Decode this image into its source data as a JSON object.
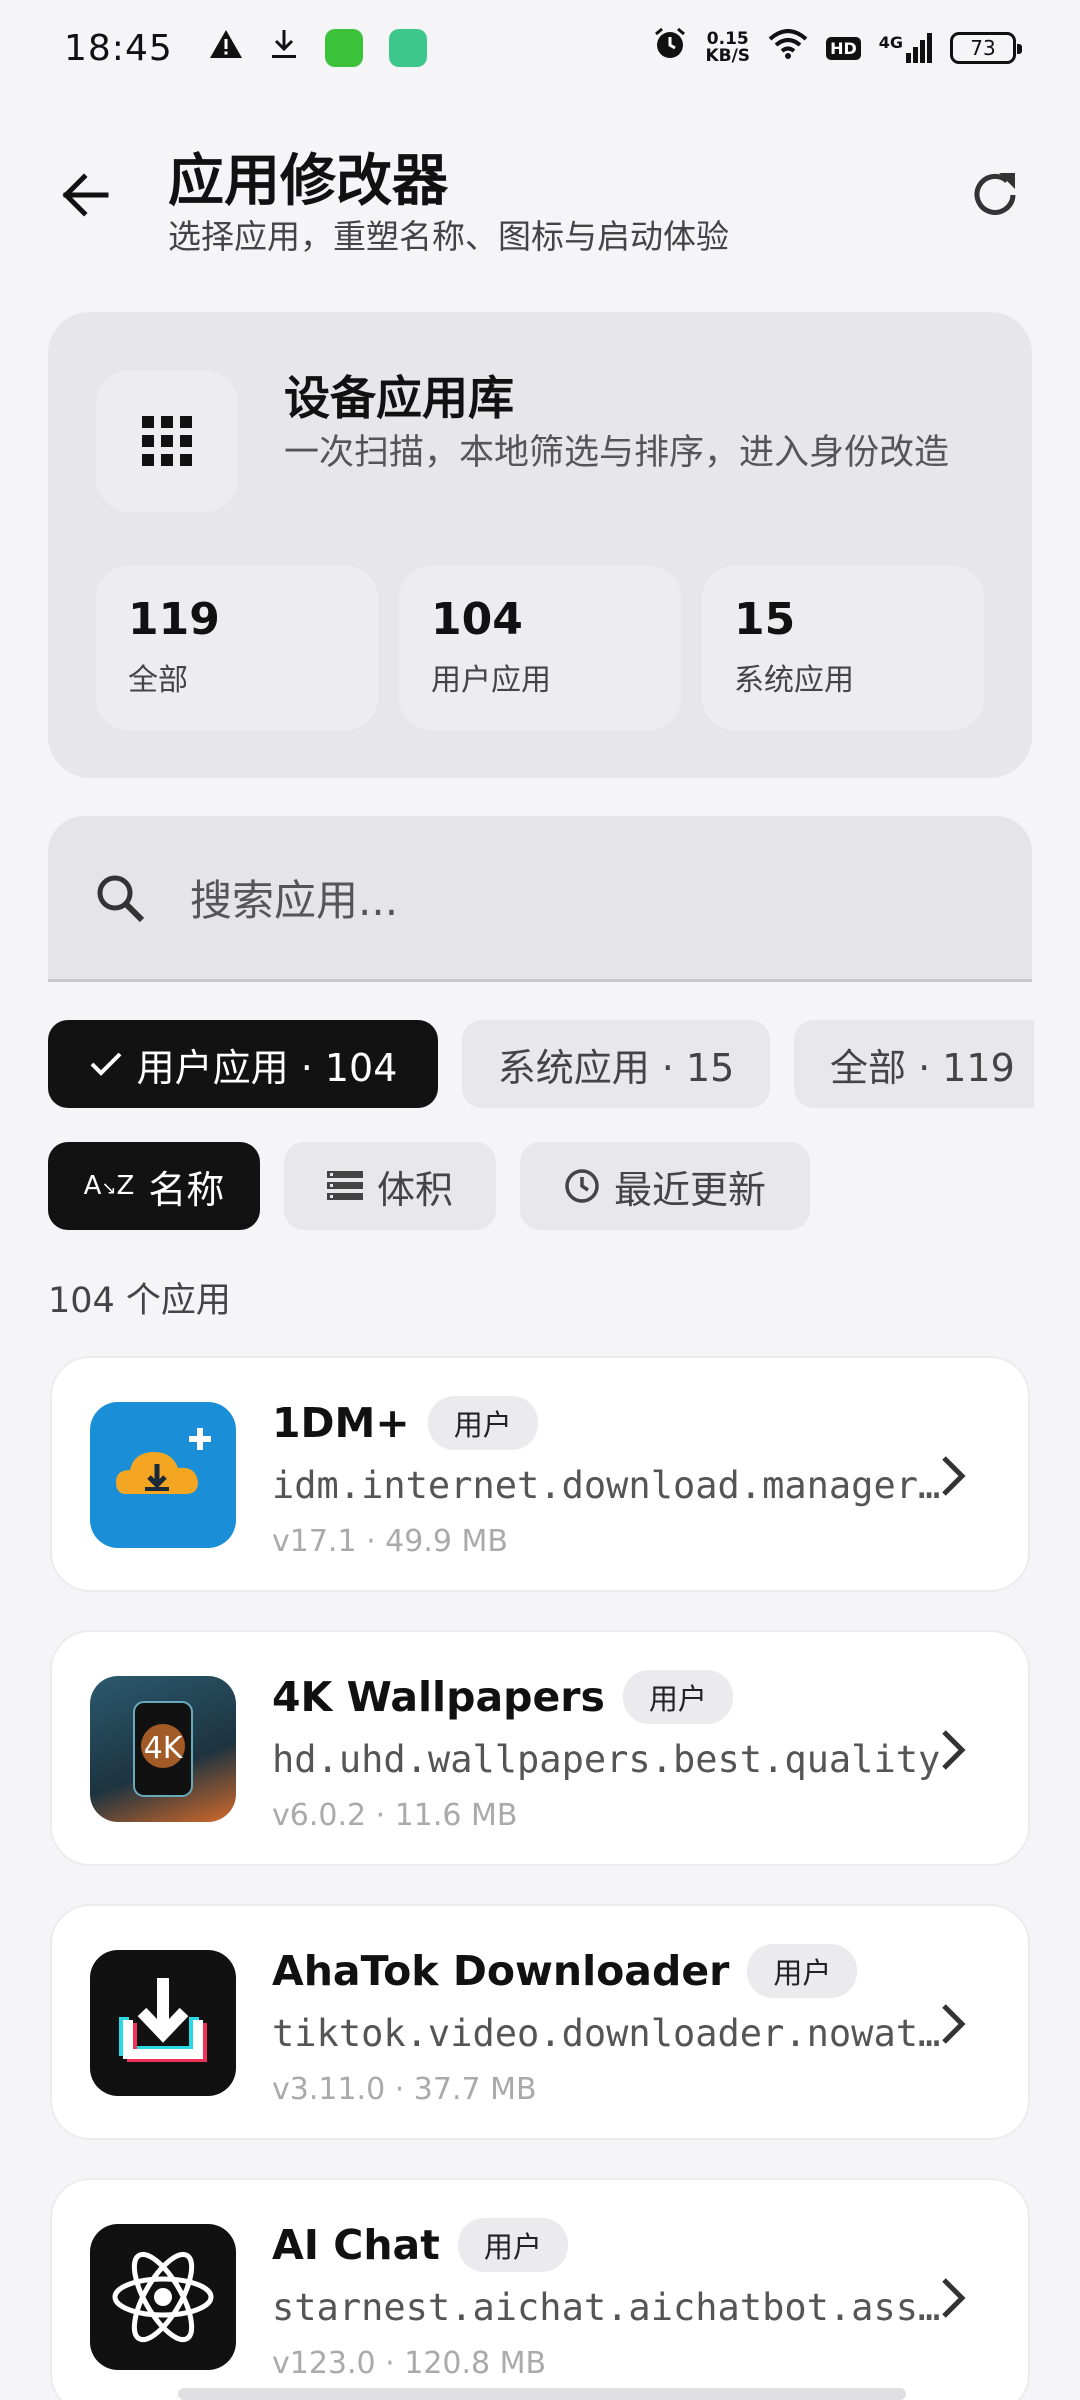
{
  "status_bar": {
    "time": "18:45",
    "net_speed_value": "0.15",
    "net_speed_unit": "KB/S",
    "hd": "HD",
    "signal": "4G",
    "battery": "73"
  },
  "header": {
    "title": "应用修改器",
    "subtitle": "选择应用，重塑名称、图标与启动体验"
  },
  "library": {
    "title": "设备应用库",
    "description": "一次扫描，本地筛选与排序，进入身份改造",
    "stats": [
      {
        "value": "119",
        "label": "全部"
      },
      {
        "value": "104",
        "label": "用户应用"
      },
      {
        "value": "15",
        "label": "系统应用"
      }
    ]
  },
  "search": {
    "placeholder": "搜索应用..."
  },
  "filters": [
    {
      "label": "用户应用 · 104",
      "active": true
    },
    {
      "label": "系统应用 · 15",
      "active": false
    },
    {
      "label": "全部 · 119",
      "active": false
    }
  ],
  "sorts": [
    {
      "label": "名称",
      "active": true
    },
    {
      "label": "体积",
      "active": false
    },
    {
      "label": "最近更新",
      "active": false
    }
  ],
  "list_count": "104 个应用",
  "apps": [
    {
      "name": "1DM+",
      "tag": "用户",
      "package": "idm.internet.download.manager.plus",
      "meta": "v17.1 · 49.9 MB"
    },
    {
      "name": "4K Wallpapers",
      "tag": "用户",
      "package": "hd.uhd.wallpapers.best.quality",
      "meta": "v6.0.2 · 11.6 MB"
    },
    {
      "name": "AhaTok Downloader",
      "tag": "用户",
      "package": "tiktok.video.downloader.nowatermark",
      "meta": "v3.11.0 · 37.7 MB"
    },
    {
      "name": "AI Chat",
      "tag": "用户",
      "package": "starnest.aichat.aichatbot.assistant",
      "meta": "v123.0 · 120.8 MB"
    }
  ],
  "colors": {
    "background": "#f5f5f7",
    "card": "#e7e7ea",
    "chip_active": "#121212",
    "accent_1dm": "#1a8fd8"
  }
}
